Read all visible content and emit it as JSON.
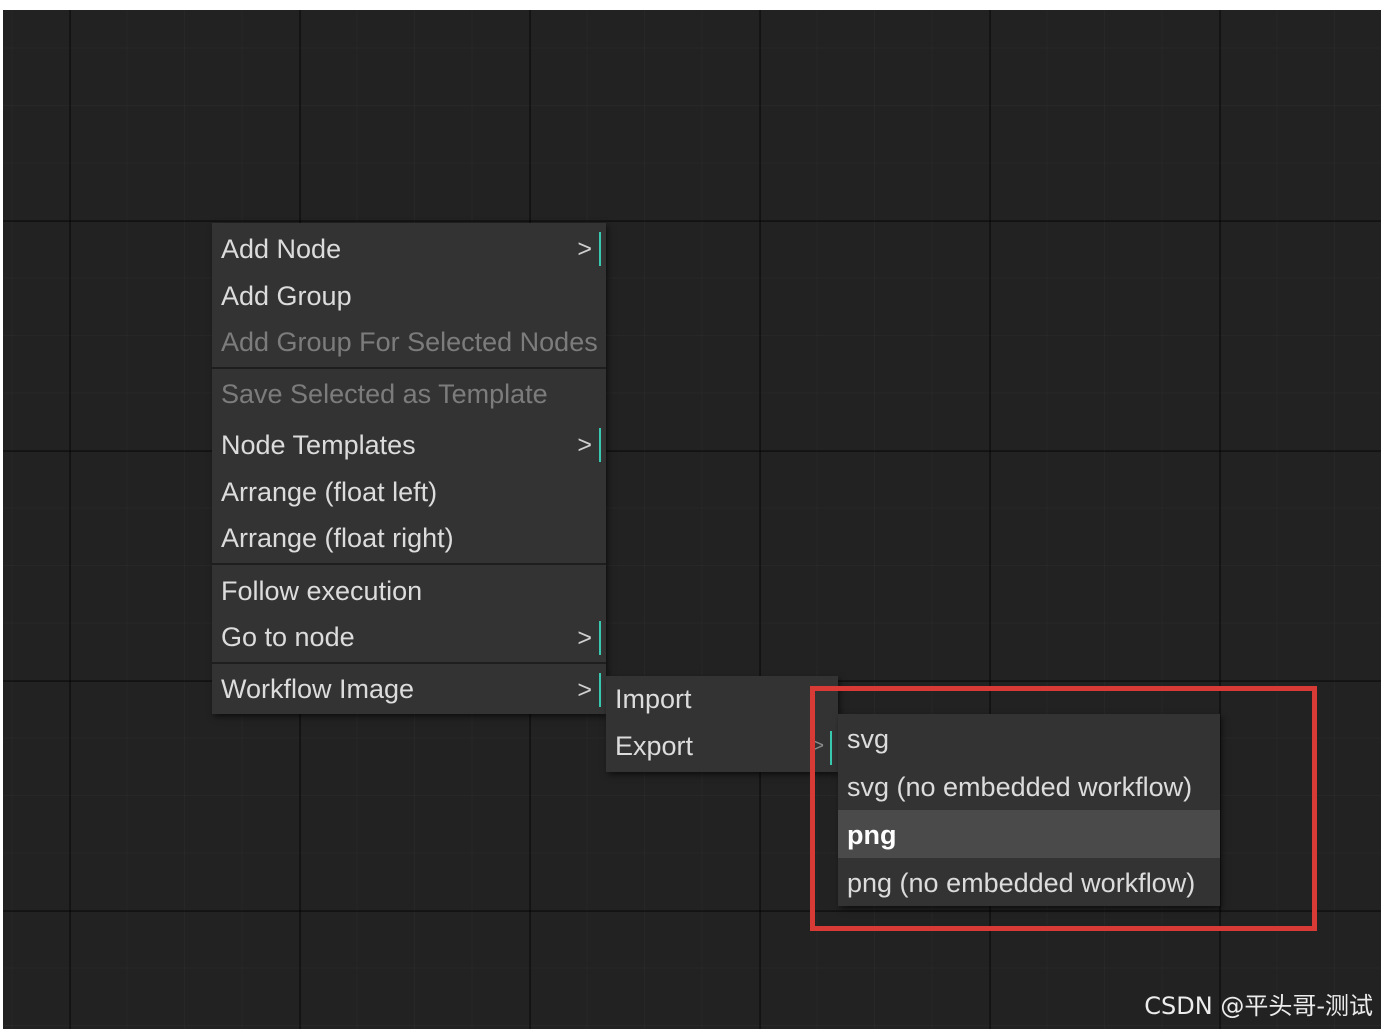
{
  "context_menu": {
    "items": [
      {
        "label": "Add Node",
        "submenu": true,
        "disabled": false
      },
      {
        "label": "Add Group",
        "submenu": false,
        "disabled": false
      },
      {
        "label": "Add Group For Selected Nodes",
        "submenu": false,
        "disabled": true
      },
      {
        "label": "Save Selected as Template",
        "submenu": false,
        "disabled": true
      },
      {
        "label": "Node Templates",
        "submenu": true,
        "disabled": false
      },
      {
        "label": "Arrange (float left)",
        "submenu": false,
        "disabled": false
      },
      {
        "label": "Arrange (float right)",
        "submenu": false,
        "disabled": false
      },
      {
        "label": "Follow execution",
        "submenu": false,
        "disabled": false
      },
      {
        "label": "Go to node",
        "submenu": true,
        "disabled": false
      },
      {
        "label": "Workflow Image",
        "submenu": true,
        "disabled": false
      }
    ],
    "submenu_arrow": ">"
  },
  "workflow_image_menu": {
    "items": [
      {
        "label": "Import",
        "submenu": false
      },
      {
        "label": "Export",
        "submenu": true
      }
    ],
    "submenu_arrow": ">"
  },
  "export_menu": {
    "items": [
      {
        "label": "svg",
        "highlighted": false
      },
      {
        "label": "svg (no embedded workflow)",
        "highlighted": false
      },
      {
        "label": "png",
        "highlighted": true
      },
      {
        "label": "png (no embedded workflow)",
        "highlighted": false
      }
    ]
  },
  "watermark": "CSDN @平头哥-测试",
  "colors": {
    "canvas_background": "#222222",
    "menu_background": "#333333",
    "submenu_indicator": "#39c9b0",
    "annotation_box": "#d83a36"
  }
}
